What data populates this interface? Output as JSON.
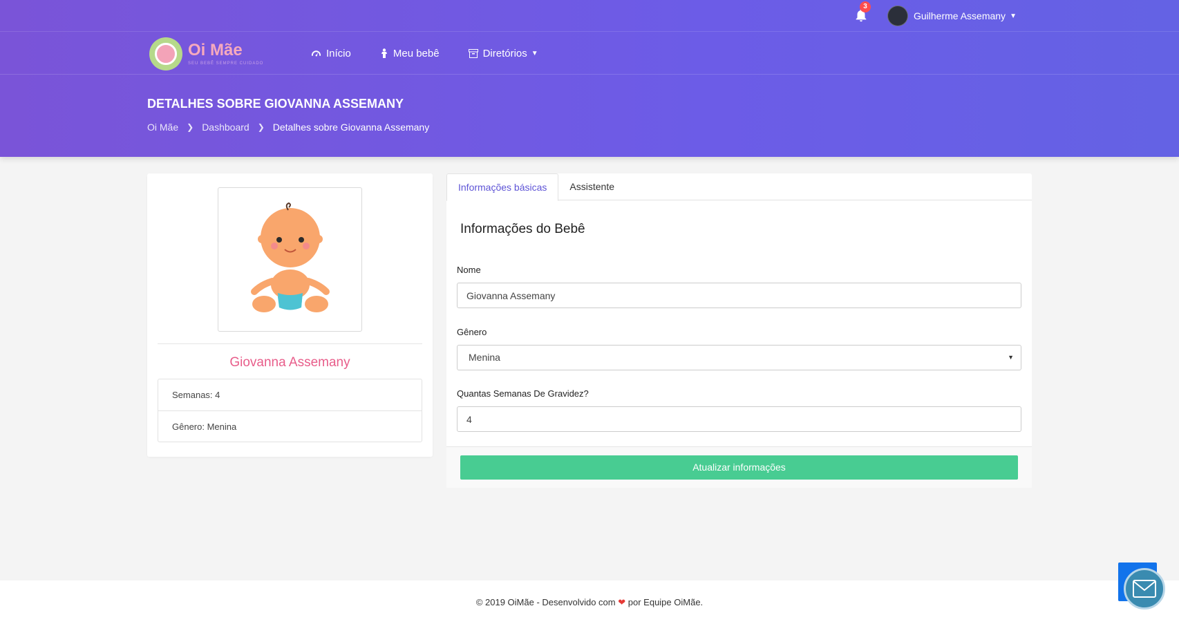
{
  "topbar": {
    "notification_count": "3",
    "user_name": "Guilherme Assemany"
  },
  "brand": {
    "name": "Oi Mãe",
    "tagline": "SEU BEBÊ SEMPRE CUIDADO"
  },
  "nav": {
    "items": [
      {
        "label": "Início",
        "icon": "dashboard-icon"
      },
      {
        "label": "Meu bebê",
        "icon": "baby-icon"
      },
      {
        "label": "Diretórios",
        "icon": "archive-icon"
      }
    ]
  },
  "page": {
    "title": "DETALHES SOBRE GIOVANNA ASSEMANY",
    "breadcrumb": [
      "Oi Mãe",
      "Dashboard",
      "Detalhes sobre Giovanna Assemany"
    ]
  },
  "profile": {
    "name": "Giovanna Assemany",
    "weeks_label": "Semanas: 4",
    "gender_label": "Gênero: Menina"
  },
  "tabs": [
    "Informações básicas",
    "Assistente"
  ],
  "form": {
    "title": "Informações do Bebê",
    "name_label": "Nome",
    "name_value": "Giovanna Assemany",
    "gender_label": "Gênero",
    "gender_value": "Menina",
    "weeks_label": "Quantas Semanas De Gravidez?",
    "weeks_value": "4",
    "submit_label": "Atualizar informações"
  },
  "footer": {
    "prefix": "© 2019 OiMãe - Desenvolvido com",
    "suffix": "por Equipe OiMãe."
  },
  "colors": {
    "header_gradient": [
      "#7a54d8",
      "#6462e4"
    ],
    "accent": "#5e54d6",
    "profile_name": "#e85d8a",
    "submit": "#48cc92",
    "badge": "#ff4d4f"
  }
}
